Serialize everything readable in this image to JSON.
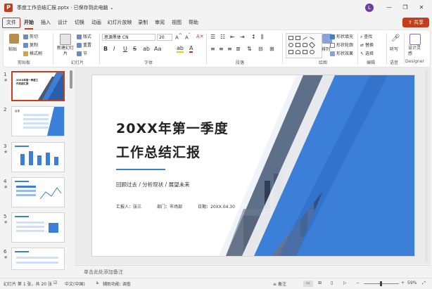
{
  "titlebar": {
    "app_letter": "P",
    "filename": "季度工作总结汇报.pptx",
    "save_status": "· 已保存到此电脑",
    "user_initial": "L",
    "minimize": "—",
    "restore": "❐",
    "close": "✕"
  },
  "tabs": [
    "文件",
    "开始",
    "插入",
    "设计",
    "切换",
    "动画",
    "幻灯片放映",
    "录制",
    "审阅",
    "视图",
    "帮助"
  ],
  "share_label": "共享",
  "ribbon": {
    "clipboard": {
      "paste": "粘贴",
      "cut": "剪切",
      "copy": "复制",
      "format_painter": "格式刷",
      "label": "剪贴板"
    },
    "slides": {
      "new_slide": "新建幻灯片",
      "layout": "版式",
      "reset": "重置",
      "section": "节",
      "label": "幻灯片"
    },
    "font": {
      "font_name": "思源黑体 CN",
      "font_size": "20",
      "bold": "B",
      "italic": "I",
      "underline": "U",
      "strike": "S",
      "label": "字体"
    },
    "paragraph": {
      "label": "段落"
    },
    "drawing": {
      "fill": "形状填充",
      "outline": "形状轮廓",
      "effects": "形状效果",
      "arrange": "排列",
      "quick_styles": "快速样式",
      "label": "绘图"
    },
    "editing": {
      "find": "查找",
      "replace": "替换",
      "select": "选择",
      "label": "编辑"
    },
    "voice": {
      "dictate": "听写",
      "label": "语音"
    },
    "designer": {
      "ideas": "设计灵感",
      "label": "Designer"
    }
  },
  "thumbnails": [
    {
      "num": "1",
      "title": "20XX年第一季度工作总结汇报"
    },
    {
      "num": "2",
      "title": "目录"
    },
    {
      "num": "3",
      "title": ""
    },
    {
      "num": "4",
      "title": ""
    },
    {
      "num": "5",
      "title": ""
    },
    {
      "num": "6",
      "title": ""
    }
  ],
  "slide": {
    "title_line1": "20XX年第一季度",
    "title_line2": "工作总结汇报",
    "subtitle": "回顾过去 / 分析现状 / 展望未来",
    "reporter": "汇报人：张三",
    "department": "部门：市场部",
    "date": "日期：20XX.04.30",
    "accent_color": "#3b7fd9"
  },
  "notes_placeholder": "单击此处添加备注",
  "status": {
    "slide_count": "幻灯片 第 1 张，共 20 张",
    "language": "中文(中国)",
    "accessibility": "辅助功能: 调查",
    "notes_btn": "备注",
    "zoom": "59%"
  }
}
